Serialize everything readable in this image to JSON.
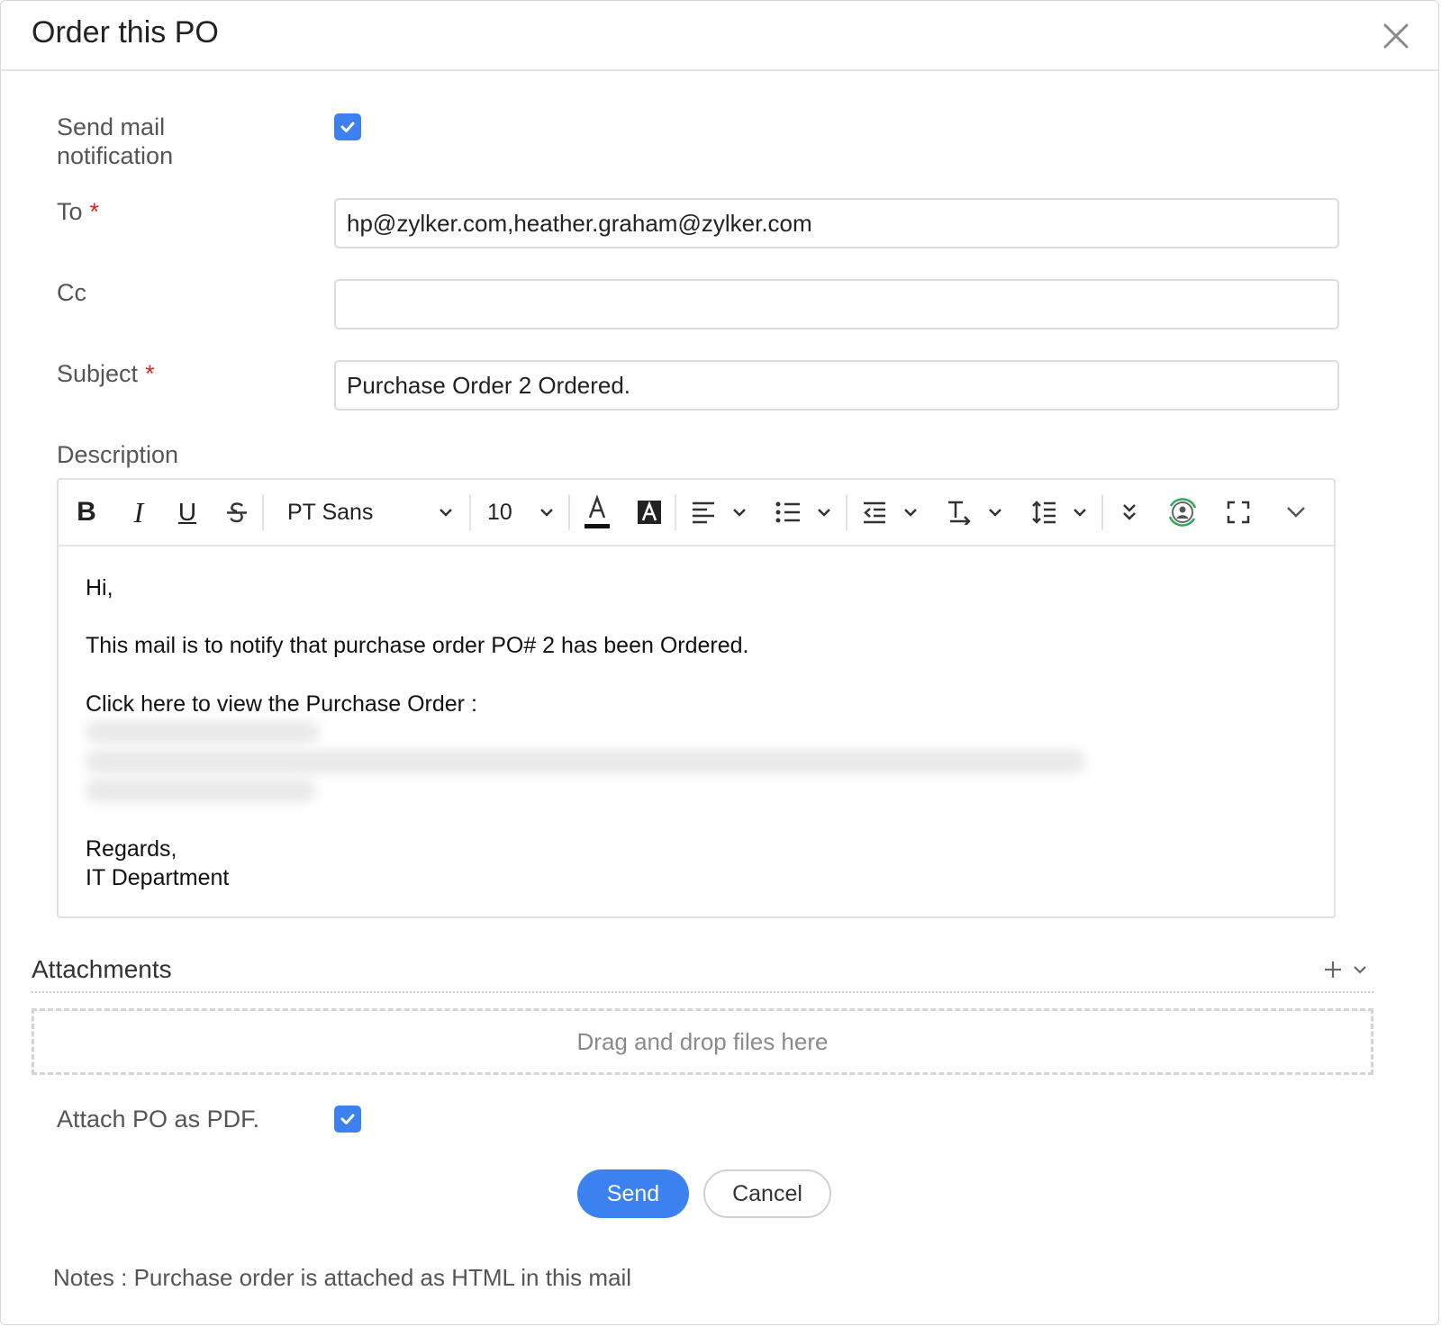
{
  "dialog": {
    "title": "Order this PO",
    "close_icon": "close-icon"
  },
  "form": {
    "send_mail_label_line1": "Send mail",
    "send_mail_label_line2": "notification",
    "send_mail_checked": true,
    "to_label": "To",
    "to_value": "hp@zylker.com,heather.graham@zylker.com",
    "cc_label": "Cc",
    "cc_value": "",
    "subject_label": "Subject",
    "subject_value": "Purchase Order 2 Ordered.",
    "required_mark": "*",
    "description_label": "Description"
  },
  "toolbar": {
    "bold": "B",
    "italic": "I",
    "underline": "U",
    "font_family": "PT Sans",
    "font_size": "10",
    "icons": [
      "bold-icon",
      "italic-icon",
      "underline-icon",
      "strikethrough-icon",
      "font-family-dropdown",
      "font-size-dropdown",
      "text-color-icon",
      "highlight-color-icon",
      "align-left-icon",
      "bullet-list-icon",
      "outdent-icon",
      "clear-format-icon",
      "line-height-icon",
      "more-options-icon",
      "merge-field-icon",
      "fullscreen-icon",
      "collapse-chevron-icon"
    ]
  },
  "editor_body": {
    "greeting": "Hi,",
    "line1": "This mail is to notify that purchase order PO# 2 has been Ordered.",
    "line2": "Click here to view the Purchase Order :",
    "closing": "Regards,",
    "signature": "IT Department"
  },
  "attachments": {
    "title": "Attachments",
    "drop_text": "Drag and drop files here",
    "attach_pdf_label": "Attach PO as PDF.",
    "attach_pdf_checked": true
  },
  "actions": {
    "send_label": "Send",
    "cancel_label": "Cancel"
  },
  "notes": "Notes : Purchase order is attached as HTML in this mail",
  "colors": {
    "accent": "#3b82f0",
    "required": "#e02020",
    "merge_icon": "#2eaa52"
  }
}
